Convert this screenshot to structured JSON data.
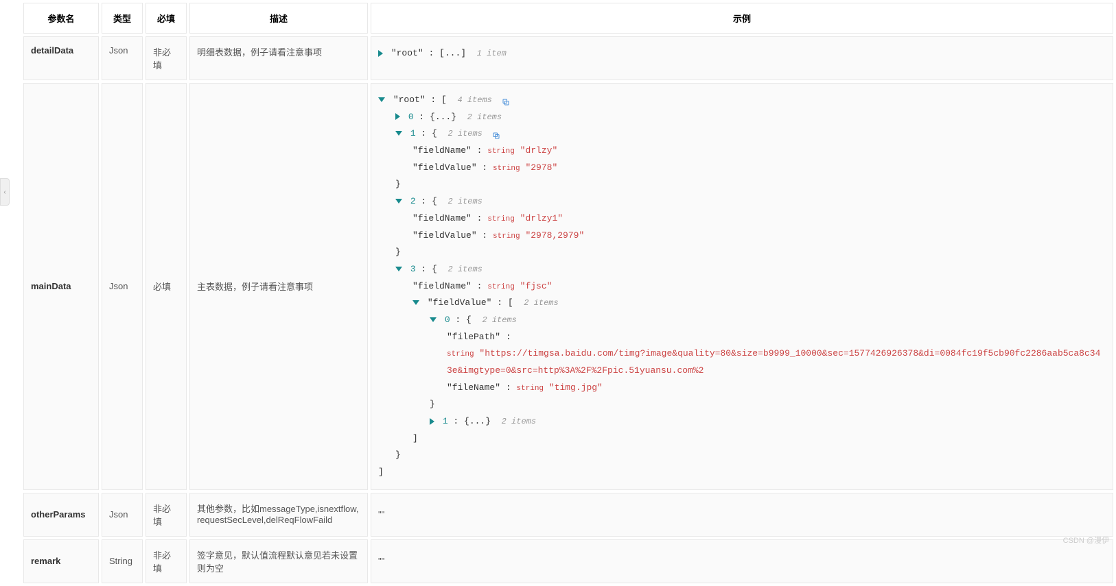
{
  "headers": {
    "param": "参数名",
    "type": "类型",
    "required": "必填",
    "desc": "描述",
    "example": "示例"
  },
  "rows": [
    {
      "param": "detailData",
      "type": "Json",
      "required": "非必填",
      "desc": "明细表数据，例子请看注意事项"
    },
    {
      "param": "mainData",
      "type": "Json",
      "required": "必填",
      "desc": "主表数据，例子请看注意事项"
    },
    {
      "param": "otherParams",
      "type": "Json",
      "required": "非必填",
      "desc": "其他参数，比如messageType,isnextflow,requestSecLevel,delReqFlowFaild",
      "example": "\"\""
    },
    {
      "param": "remark",
      "type": "String",
      "required": "非必填",
      "desc": "签字意见，默认值流程默认意见若未设置则为空",
      "example": "\"\""
    }
  ],
  "tree1": {
    "root": "\"root\"",
    "collapsed": "[...]",
    "count": "1 item"
  },
  "tree2": {
    "root": "\"root\"",
    "rootCount": "4 items",
    "item0": {
      "idx": "0",
      "collapsed": "{...}",
      "count": "2 items"
    },
    "item1": {
      "idx": "1",
      "count": "2 items",
      "fieldName": {
        "k": "\"fieldName\"",
        "t": "string",
        "v": "\"drlzy\""
      },
      "fieldValue": {
        "k": "\"fieldValue\"",
        "t": "string",
        "v": "\"2978\""
      }
    },
    "item2": {
      "idx": "2",
      "count": "2 items",
      "fieldName": {
        "k": "\"fieldName\"",
        "t": "string",
        "v": "\"drlzy1\""
      },
      "fieldValue": {
        "k": "\"fieldValue\"",
        "t": "string",
        "v": "\"2978,2979\""
      }
    },
    "item3": {
      "idx": "3",
      "count": "2 items",
      "fieldName": {
        "k": "\"fieldName\"",
        "t": "string",
        "v": "\"fjsc\""
      },
      "fieldValue": {
        "k": "\"fieldValue\"",
        "count": "2 items",
        "item0": {
          "idx": "0",
          "count": "2 items",
          "filePath": {
            "k": "\"filePath\"",
            "t": "string",
            "v": "\"https://timgsa.baidu.com/timg?image&quality=80&size=b9999_10000&sec=1577426926378&di=0084fc19f5cb90fc2286aab5ca8c343e&imgtype=0&src=http%3A%2F%2Fpic.51yuansu.com%2"
          },
          "fileName": {
            "k": "\"fileName\"",
            "t": "string",
            "v": "\"timg.jpg\""
          }
        },
        "item1": {
          "idx": "1",
          "collapsed": "{...}",
          "count": "2 items"
        }
      }
    }
  },
  "watermark": "CSDN @漫伊"
}
